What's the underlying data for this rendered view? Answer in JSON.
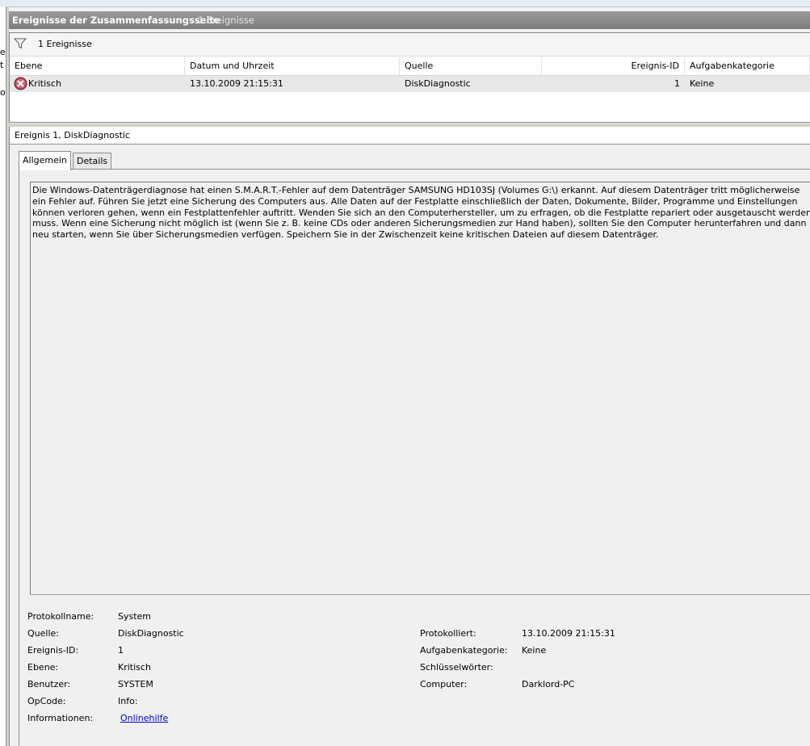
{
  "summary": {
    "title": "Ereignisse der Zusammenfassungsseite",
    "count_label": "1 Ereignisse"
  },
  "filter": {
    "icon": "filter-icon",
    "count_label": "1 Ereignisse"
  },
  "table": {
    "columns": [
      "Ebene",
      "Datum und Uhrzeit",
      "Quelle",
      "Ereignis-ID",
      "Aufgabenkategorie"
    ],
    "rows": [
      {
        "icon": "critical-error-icon",
        "level": "Kritisch",
        "datetime": "13.10.2009 21:15:31",
        "source": "DiskDiagnostic",
        "event_id": "1",
        "category": "Keine"
      }
    ]
  },
  "detail": {
    "header": "Ereignis 1, DiskDiagnostic",
    "tabs": [
      "Allgemein",
      "Details"
    ],
    "active_tab": "Allgemein",
    "message": "Die Windows-Datenträgerdiagnose hat einen S.M.A.R.T.-Fehler auf dem Datenträger SAMSUNG HD103SJ (Volumes G:\\) erkannt. Auf diesem Datenträger tritt möglicherweise ein Fehler auf. Führen Sie jetzt eine Sicherung des Computers aus. Alle Daten auf der Festplatte einschließlich der Daten, Dokumente, Bilder, Programme und Einstellungen können verloren gehen, wenn ein Festplattenfehler auftritt. Wenden Sie sich an den Computerhersteller, um zu erfragen, ob die Festplatte repariert oder ausgetauscht werden muss. Wenn eine Sicherung nicht möglich ist (wenn Sie z. B. keine CDs oder anderen Sicherungsmedien zur Hand haben), sollten Sie den Computer herunterfahren und dann neu starten, wenn Sie über Sicherungsmedien verfügen. Speichern Sie in der Zwischenzeit keine kritischen Dateien auf diesem Datenträger.",
    "fields": {
      "protokollname_label": "Protokollname:",
      "protokollname_value": "System",
      "quelle_label": "Quelle:",
      "quelle_value": "DiskDiagnostic",
      "ereignis_id_label": "Ereignis-ID:",
      "ereignis_id_value": "1",
      "ebene_label": "Ebene:",
      "ebene_value": "Kritisch",
      "benutzer_label": "Benutzer:",
      "benutzer_value": "SYSTEM",
      "opcode_label": "OpCode:",
      "opcode_value": "Info:",
      "informationen_label": "Informationen:",
      "informationen_link": "Onlinehilfe",
      "protokolliert_label": "Protokolliert:",
      "protokolliert_value": "13.10.2009 21:15:31",
      "aufgabenkategorie_label": "Aufgabenkategorie:",
      "aufgabenkategorie_value": "Keine",
      "schluesselwoerter_label": "Schlüsselwörter:",
      "schluesselwoerter_value": "",
      "computer_label": "Computer:",
      "computer_value": "Darklord-PC"
    }
  },
  "left_pane": {
    "fragments": [
      "e",
      "t",
      "o"
    ]
  },
  "colors": {
    "title_bar": "#8a8a8a",
    "selected_row": "#e8e8e8",
    "link": "#0000cc",
    "critical_icon": "#b4475a"
  }
}
